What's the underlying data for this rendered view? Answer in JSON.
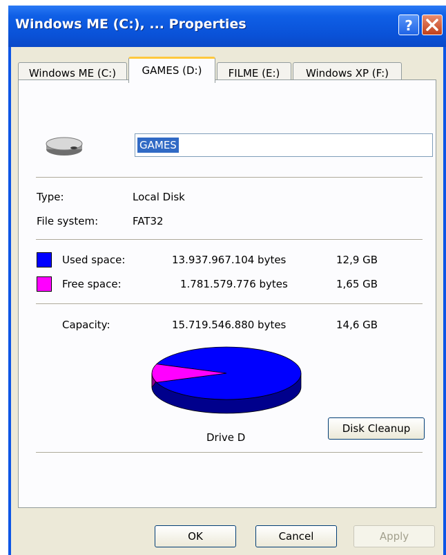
{
  "window": {
    "title": "Windows ME (C:), ... Properties"
  },
  "tabs": [
    {
      "label": "Windows ME (C:)"
    },
    {
      "label": "GAMES (D:)"
    },
    {
      "label": "FILME (E:)"
    },
    {
      "label": "Windows XP (F:)"
    }
  ],
  "general": {
    "name_value": "GAMES",
    "type_label": "Type:",
    "type_value": "Local Disk",
    "fs_label": "File system:",
    "fs_value": "FAT32",
    "used_label": "Used space:",
    "used_bytes": "13.937.967.104 bytes",
    "used_gb": "12,9 GB",
    "free_label": "Free space:",
    "free_bytes": "1.781.579.776 bytes",
    "free_gb": "1,65 GB",
    "capacity_label": "Capacity:",
    "capacity_bytes": "15.719.546.880 bytes",
    "capacity_gb": "14,6 GB",
    "drive_label": "Drive D",
    "cleanup_label": "Disk Cleanup"
  },
  "colors": {
    "used": "#0000ff",
    "free": "#ff00ff",
    "used_side": "#00008c",
    "free_side": "#8c008c"
  },
  "chart_data": {
    "type": "pie",
    "categories": [
      "Used space",
      "Free space"
    ],
    "values": [
      13937967104,
      1781579776
    ]
  },
  "buttons": {
    "ok": "OK",
    "cancel": "Cancel",
    "apply": "Apply"
  }
}
